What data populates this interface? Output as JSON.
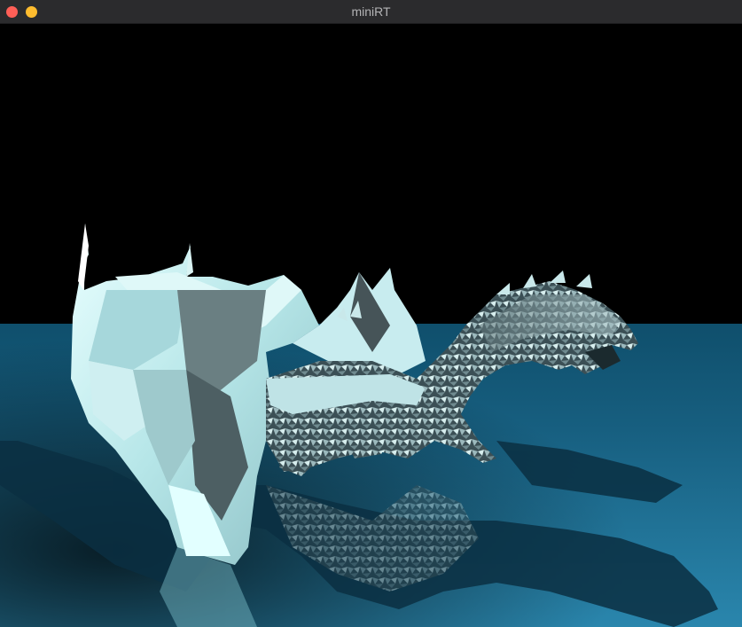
{
  "window": {
    "title": "miniRT",
    "controls": {
      "close_color": "#ff5f57",
      "minimize_color": "#febc2e"
    }
  },
  "scene": {
    "background_color": "#000000",
    "floor_color": "#1f6f95",
    "object_icon": "dragon-render",
    "object_color": "#bfeff0"
  }
}
